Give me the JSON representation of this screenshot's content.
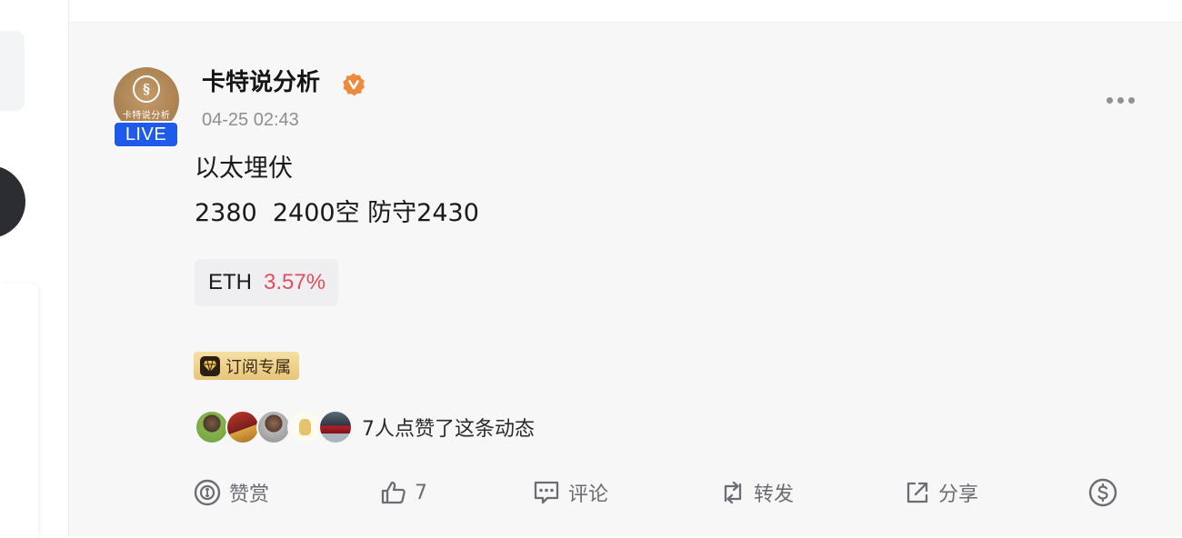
{
  "post": {
    "author": {
      "name": "卡特说分析",
      "avatar_text": "卡特说分析",
      "live_label": "LIVE",
      "verified_icon": "verified-badge-icon"
    },
    "time": "04-25 02:43",
    "content_lines": [
      "以太埋伏",
      "2380  2400空 防守2430"
    ],
    "ticker": {
      "symbol": "ETH",
      "change": "3.57%",
      "change_color": "#e04f5f"
    },
    "subscription_badge": "订阅专属",
    "likes_summary": "7人点赞了这条动态",
    "actions": {
      "tip": "赞赏",
      "like_count": "7",
      "comment": "评论",
      "repost": "转发",
      "share": "分享"
    }
  },
  "colors": {
    "live_badge": "#1f5bea",
    "verified": "#ee8a3c",
    "card_bg": "#f7f7f8",
    "subscription_gold": "#e8c47a"
  }
}
